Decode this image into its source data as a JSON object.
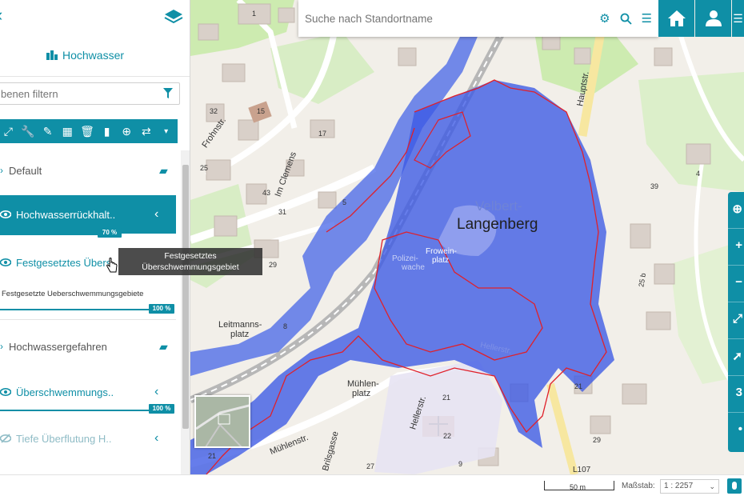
{
  "sidebar": {
    "title": "Hochwasser",
    "filter_placeholder": "benen filtern",
    "layers": {
      "default": "Default",
      "hwr": "Hochwasserrückhalt..",
      "hwr_opacity": "70 %",
      "fest": "Festgesetztes Übers..",
      "fest_sub": "Festgesetzte Ueberschwemmungsgebiete",
      "fest_opacity": "100 %",
      "gefahren": "Hochwassergefahren",
      "ueb": "Überschwemmungs..",
      "ueb_opacity": "100 %",
      "tief": "Tiefe Überflutung H.."
    },
    "tooltip": "Festgesetztes Überschwemmungsgebiet"
  },
  "search": {
    "placeholder": "Suche nach Standortname"
  },
  "map_labels": {
    "frohnstr": "Frohnstr.",
    "clemens": "Im Clemens",
    "haupt": "Hauptstr.",
    "velbert": "Velbert-",
    "langenberg": "Langenberg",
    "polizei1": "Polizei-",
    "polizei2": "wache",
    "froweins1": "Frowein-",
    "froweins2": "platz",
    "heller": "Hellerstr.",
    "heller2": "Hellerstr.",
    "leitmanns1": "Leitmanns-",
    "leitmanns2": "platz",
    "muehlen1": "Mühlen-",
    "muehlen2": "platz",
    "muehlenstr": "Mühlenstr.",
    "brilsgasse": "Brilsgasse",
    "l107": "L107",
    "n1": "1",
    "n15": "15",
    "n32": "32",
    "n25": "25",
    "n17": "17",
    "n43": "43",
    "n31": "31",
    "n29": "29",
    "n8": "8",
    "n21": "21",
    "n22": "22",
    "n29b": "29",
    "n21b": "21",
    "n4": "4",
    "n25b": "25 b",
    "n39": "39",
    "n5": "5",
    "n9": "9",
    "n27": "27",
    "n21c": "21"
  },
  "bottom": {
    "scale_bar": "50 m",
    "scale_label": "Maßstab:",
    "scale_value": "1 : 2257"
  },
  "colors": {
    "accent": "#0f8fa6",
    "flood": "#3b5ef0",
    "border": "#e0202a"
  }
}
